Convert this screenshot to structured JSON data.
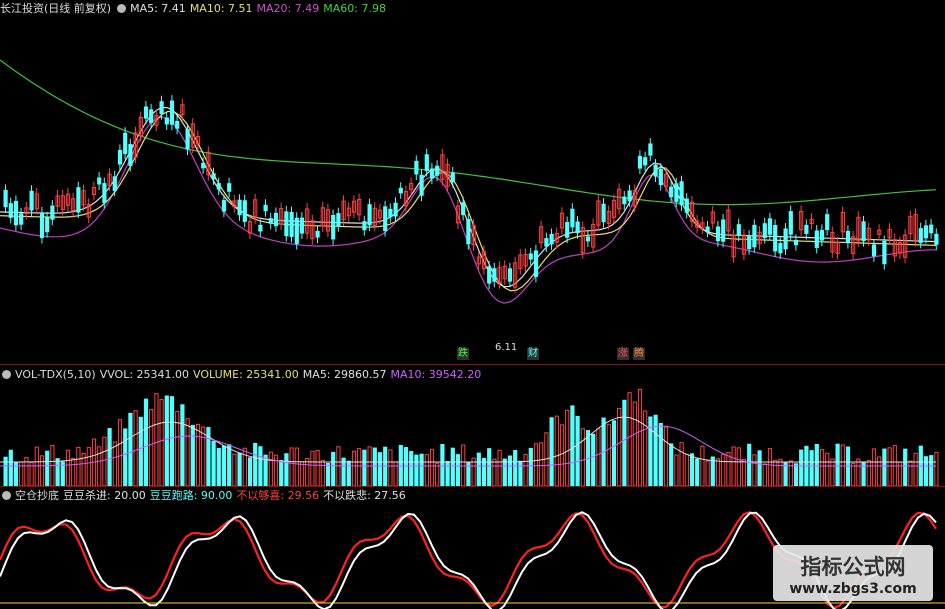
{
  "main": {
    "title": "长江投资(日线 前复权)",
    "ma5": "MA5: 7.41",
    "ma10": "MA10: 7.51",
    "ma20": "MA20: 7.49",
    "ma60": "MA60: 7.98",
    "low_marker": "6.11"
  },
  "events": [
    "跌",
    "财",
    "涨",
    "腾"
  ],
  "volume": {
    "name": "VOL-TDX(5,10)",
    "vvol": "VVOL: 25341.00",
    "vol": "VOLUME: 25341.00",
    "ma5": "MA5: 29860.57",
    "ma10": "MA10: 39542.20"
  },
  "indicator": {
    "name": "空仓抄底",
    "a": "豆豆杀进: 20.00",
    "b": "豆豆跑路: 90.00",
    "c": "不以够喜: 29.56",
    "d": "不以跌悲: 27.56"
  },
  "watermark": {
    "line1": "指标公式网",
    "line2": "www.zbgs3.com"
  },
  "colors": {
    "up": "#ff4040",
    "down": "#54ffff",
    "ma5": "#e0e0e0",
    "ma10": "#e6e070",
    "ma20": "#c040c0",
    "ma60": "#40c040",
    "vol_ma10": "#cc60ff"
  }
}
